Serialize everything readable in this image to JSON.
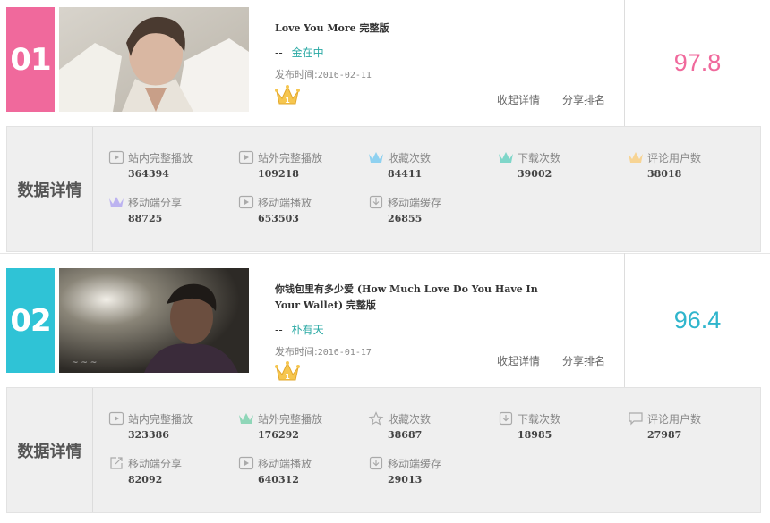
{
  "entries": [
    {
      "rank": "01",
      "rank_color": "#f0699c",
      "title": "Love You More 完整版",
      "artist_dash": "--",
      "artist": "金在中",
      "release_label": "发布时间:",
      "release_date": "2016-02-11",
      "collapse_label": "收起详情",
      "share_label": "分享排名",
      "score": "97.8",
      "score_color": "#f0699c",
      "details_label": "数据详情",
      "stats": [
        {
          "label": "站内完整播放",
          "value": "364394",
          "icon": "play-icon"
        },
        {
          "label": "站外完整播放",
          "value": "109218",
          "icon": "play-icon"
        },
        {
          "label": "收藏次数",
          "value": "84411",
          "icon": "crown-blue-icon"
        },
        {
          "label": "下载次数",
          "value": "39002",
          "icon": "crown-teal-icon"
        },
        {
          "label": "评论用户数",
          "value": "38018",
          "icon": "crown-gold-icon"
        },
        {
          "label": "移动端分享",
          "value": "88725",
          "icon": "crown-purple-icon"
        },
        {
          "label": "移动端播放",
          "value": "653503",
          "icon": "play-icon"
        },
        {
          "label": "移动端缓存",
          "value": "26855",
          "icon": "download-icon"
        }
      ]
    },
    {
      "rank": "02",
      "rank_color": "#2fc3d6",
      "title": "你钱包里有多少爱 (How Much Love Do You Have In Your Wallet) 完整版",
      "artist_dash": "--",
      "artist": "朴有天",
      "release_label": "发布时间:",
      "release_date": "2016-01-17",
      "collapse_label": "收起详情",
      "share_label": "分享排名",
      "score": "96.4",
      "score_color": "#2fb5cc",
      "details_label": "数据详情",
      "stats": [
        {
          "label": "站内完整播放",
          "value": "323386",
          "icon": "play-icon"
        },
        {
          "label": "站外完整播放",
          "value": "176292",
          "icon": "crown-teal-icon"
        },
        {
          "label": "收藏次数",
          "value": "38687",
          "icon": "star-icon"
        },
        {
          "label": "下载次数",
          "value": "18985",
          "icon": "download-icon"
        },
        {
          "label": "评论用户数",
          "value": "27987",
          "icon": "comment-icon"
        },
        {
          "label": "移动端分享",
          "value": "82092",
          "icon": "share-icon"
        },
        {
          "label": "移动端播放",
          "value": "640312",
          "icon": "play-icon"
        },
        {
          "label": "移动端缓存",
          "value": "29013",
          "icon": "download-icon"
        }
      ]
    }
  ]
}
